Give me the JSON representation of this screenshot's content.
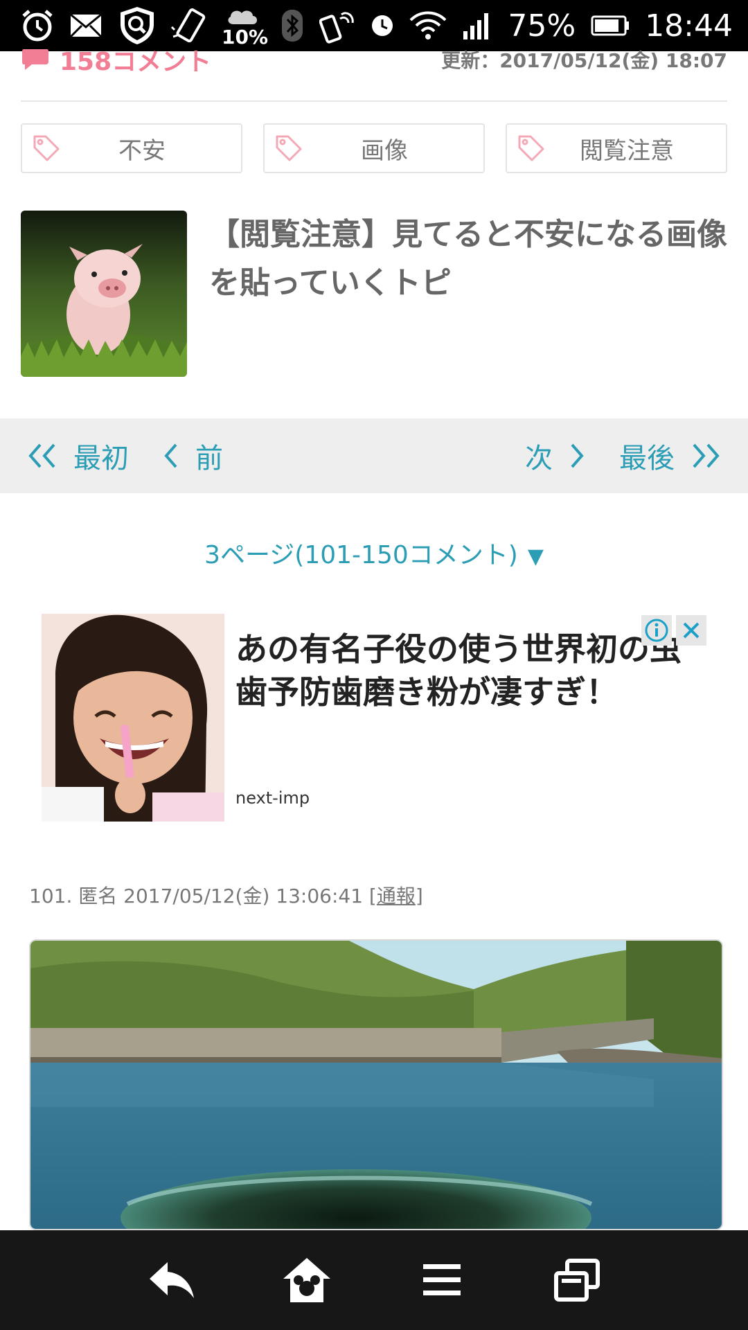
{
  "status_bar": {
    "cloud_percent": "10%",
    "battery": "75%",
    "time": "18:44"
  },
  "meta": {
    "comment_count": "158コメント",
    "updated": "更新：2017/05/12(金) 18:07"
  },
  "tags": [
    {
      "label": "不安"
    },
    {
      "label": "画像"
    },
    {
      "label": "閲覧注意"
    }
  ],
  "article": {
    "title": "【閲覧注意】見てると不安になる画像を貼っていくトピ"
  },
  "pager": {
    "first": "最初",
    "prev": "前",
    "next": "次",
    "last": "最後"
  },
  "page_select": {
    "label": "3ページ(101-150コメント)",
    "arrow": "▼"
  },
  "ad": {
    "headline": "あの有名子役の使う世界初の虫歯予防歯磨き粉が凄すぎ！",
    "source": "next-imp"
  },
  "comment": {
    "header": "101. 匿名 2017/05/12(金) 13:06:41 [",
    "report": "通報",
    "header_end": "]"
  },
  "colors": {
    "accent_pink": "#f27e96",
    "link_blue": "#2b9db5",
    "pager_bg": "#eeeeee",
    "bottom_nav_bg": "#171717"
  },
  "icons": {
    "status": [
      "alarm-icon",
      "mail-icon",
      "shield-search-icon",
      "phone-rotate-icon",
      "cloud-icon",
      "bluetooth-icon",
      "nfc-icon",
      "clock-icon",
      "wifi-icon",
      "signal-icon",
      "battery-icon"
    ],
    "bottom_nav": [
      "back-icon",
      "home-icon",
      "menu-icon",
      "tabs-icon"
    ]
  }
}
